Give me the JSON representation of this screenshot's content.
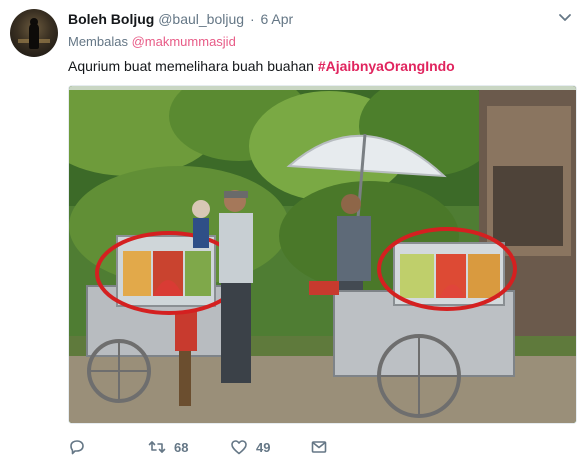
{
  "tweet": {
    "author_name": "Boleh Boljug",
    "author_handle": "@baul_boljug",
    "separator": "·",
    "date": "6 Apr",
    "reply_prefix": "Membalas",
    "reply_to": "@makmummasjid",
    "text": "Aqurium buat memelihara buah buahan",
    "hashtag": "#AjaibnyaOrangIndo",
    "media_icon": "photo",
    "actions": {
      "reply_icon": "reply-icon",
      "retweet_icon": "retweet-icon",
      "retweet_count": "68",
      "like_icon": "heart-icon",
      "like_count": "49",
      "dm_icon": "envelope-icon"
    }
  },
  "colors": {
    "text": "#14171a",
    "muted": "#657786",
    "hashtag": "#e0245e",
    "background": "#ffffff"
  }
}
